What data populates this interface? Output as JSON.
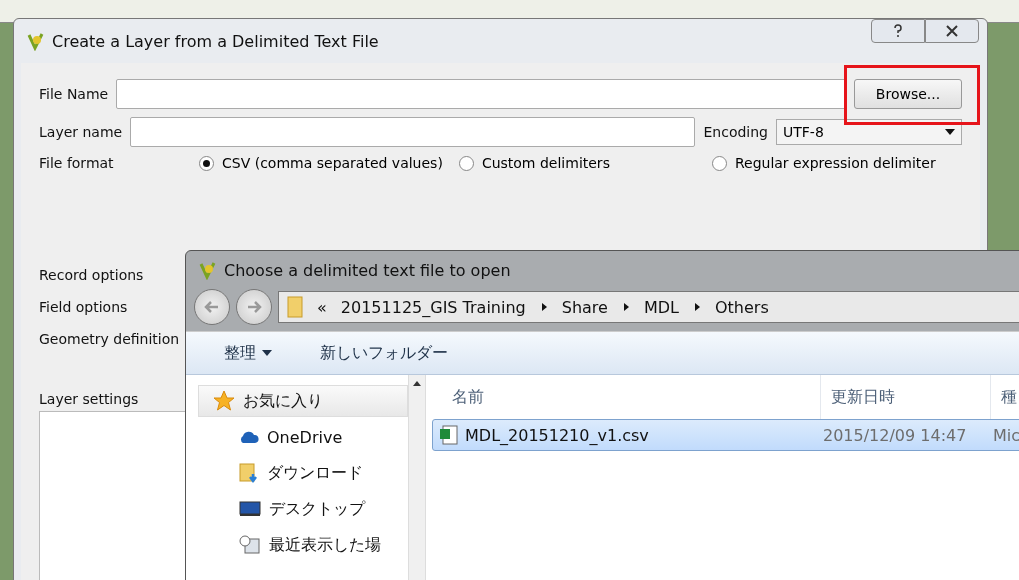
{
  "main_dialog": {
    "title": "Create a Layer from a Delimited Text File",
    "file_name": {
      "label": "File Name",
      "button": "Browse...",
      "highlighted": true
    },
    "layer_name": {
      "label": "Layer name"
    },
    "encoding": {
      "label": "Encoding",
      "value": "UTF-8"
    },
    "file_format": {
      "label": "File format",
      "options": [
        {
          "label": "CSV (comma separated values)",
          "selected": true
        },
        {
          "label": "Custom delimiters",
          "selected": false
        },
        {
          "label": "Regular expression delimiter",
          "selected": false
        }
      ]
    },
    "sections": [
      "Record options",
      "Field options",
      "Geometry definition"
    ],
    "layer_settings": {
      "label": "Layer settings"
    }
  },
  "file_dialog": {
    "title": "Choose a delimited text file to open",
    "breadcrumb": {
      "overflow": "«",
      "parts": [
        "20151125_GIS Training",
        "Share",
        "MDL",
        "Others"
      ]
    },
    "toolbar": [
      {
        "label": "整理",
        "dropdown": true
      },
      {
        "label": "新しいフォルダー",
        "dropdown": false
      }
    ],
    "nav": [
      {
        "label": "お気に入り",
        "kind": "star",
        "selected": true
      },
      {
        "label": "OneDrive",
        "kind": "cloud",
        "selected": false
      },
      {
        "label": "ダウンロード",
        "kind": "download",
        "selected": false
      },
      {
        "label": "デスクトップ",
        "kind": "desktop",
        "selected": false
      },
      {
        "label": "最近表示した場",
        "kind": "recent",
        "selected": false
      }
    ],
    "columns": [
      "名前",
      "更新日時",
      "種"
    ],
    "files": [
      {
        "name": "MDL_20151210_v1.csv",
        "modified": "2015/12/09 14:47",
        "type": "Mic",
        "selected": true
      }
    ]
  }
}
